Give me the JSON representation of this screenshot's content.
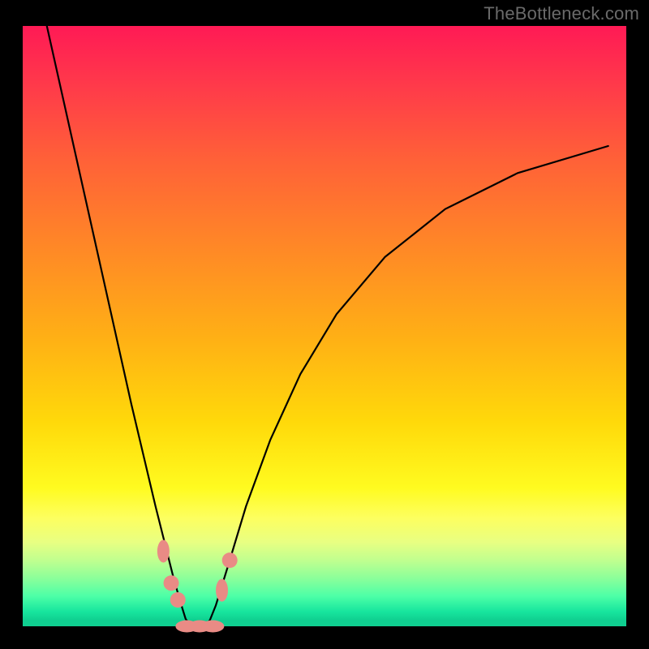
{
  "watermark": {
    "text": "TheBottleneck.com"
  },
  "chart_data": {
    "type": "line",
    "title": "",
    "xlabel": "",
    "ylabel": "",
    "xlim": [
      0,
      100
    ],
    "ylim": [
      0,
      100
    ],
    "gradient_semantics": "Top of plot (y≈100%) = worst / red; bottom (y≈0%) = best / green",
    "background_gradient_stops": [
      {
        "pos": 0.0,
        "color": "#ff1a55"
      },
      {
        "pos": 0.1,
        "color": "#ff3a4a"
      },
      {
        "pos": 0.22,
        "color": "#ff6038"
      },
      {
        "pos": 0.38,
        "color": "#ff8b25"
      },
      {
        "pos": 0.52,
        "color": "#ffb015"
      },
      {
        "pos": 0.66,
        "color": "#ffd90a"
      },
      {
        "pos": 0.77,
        "color": "#fffb20"
      },
      {
        "pos": 0.82,
        "color": "#fdff60"
      },
      {
        "pos": 0.86,
        "color": "#e8ff82"
      },
      {
        "pos": 0.89,
        "color": "#c0ff8f"
      },
      {
        "pos": 0.92,
        "color": "#8bff9a"
      },
      {
        "pos": 0.95,
        "color": "#4cffa7"
      },
      {
        "pos": 0.975,
        "color": "#18e69e"
      },
      {
        "pos": 0.99,
        "color": "#0fcf90"
      },
      {
        "pos": 1.0,
        "color": "#0fcf90"
      }
    ],
    "series": [
      {
        "name": "left-branch",
        "x": [
          4.0,
          8.0,
          12.0,
          16.0,
          18.0,
          20.0,
          22.0,
          23.5,
          25.0,
          26.2,
          27.0,
          28.0,
          29.0
        ],
        "y": [
          100.0,
          82.0,
          64.0,
          46.0,
          37.0,
          28.5,
          20.0,
          14.0,
          8.0,
          3.8,
          1.2,
          0.0,
          0.0
        ]
      },
      {
        "name": "right-branch",
        "x": [
          29.0,
          30.0,
          31.0,
          32.0,
          34.0,
          37.0,
          41.0,
          46.0,
          52.0,
          60.0,
          70.0,
          82.0,
          97.0
        ],
        "y": [
          0.0,
          0.0,
          1.0,
          3.5,
          10.0,
          20.0,
          31.0,
          42.0,
          52.0,
          61.5,
          69.5,
          75.5,
          80.0
        ]
      }
    ],
    "markers": [
      {
        "x": 23.3,
        "y": 12.5,
        "shape": "oval-vertical"
      },
      {
        "x": 24.6,
        "y": 7.2,
        "shape": "circle"
      },
      {
        "x": 25.7,
        "y": 4.4,
        "shape": "circle"
      },
      {
        "x": 27.2,
        "y": 0.0,
        "shape": "oval-horizontal"
      },
      {
        "x": 29.3,
        "y": 0.0,
        "shape": "oval-horizontal"
      },
      {
        "x": 31.5,
        "y": 0.0,
        "shape": "oval-horizontal"
      },
      {
        "x": 33.0,
        "y": 6.0,
        "shape": "oval-vertical"
      },
      {
        "x": 34.3,
        "y": 11.0,
        "shape": "circle"
      }
    ],
    "marker_color": "#e98b85"
  }
}
